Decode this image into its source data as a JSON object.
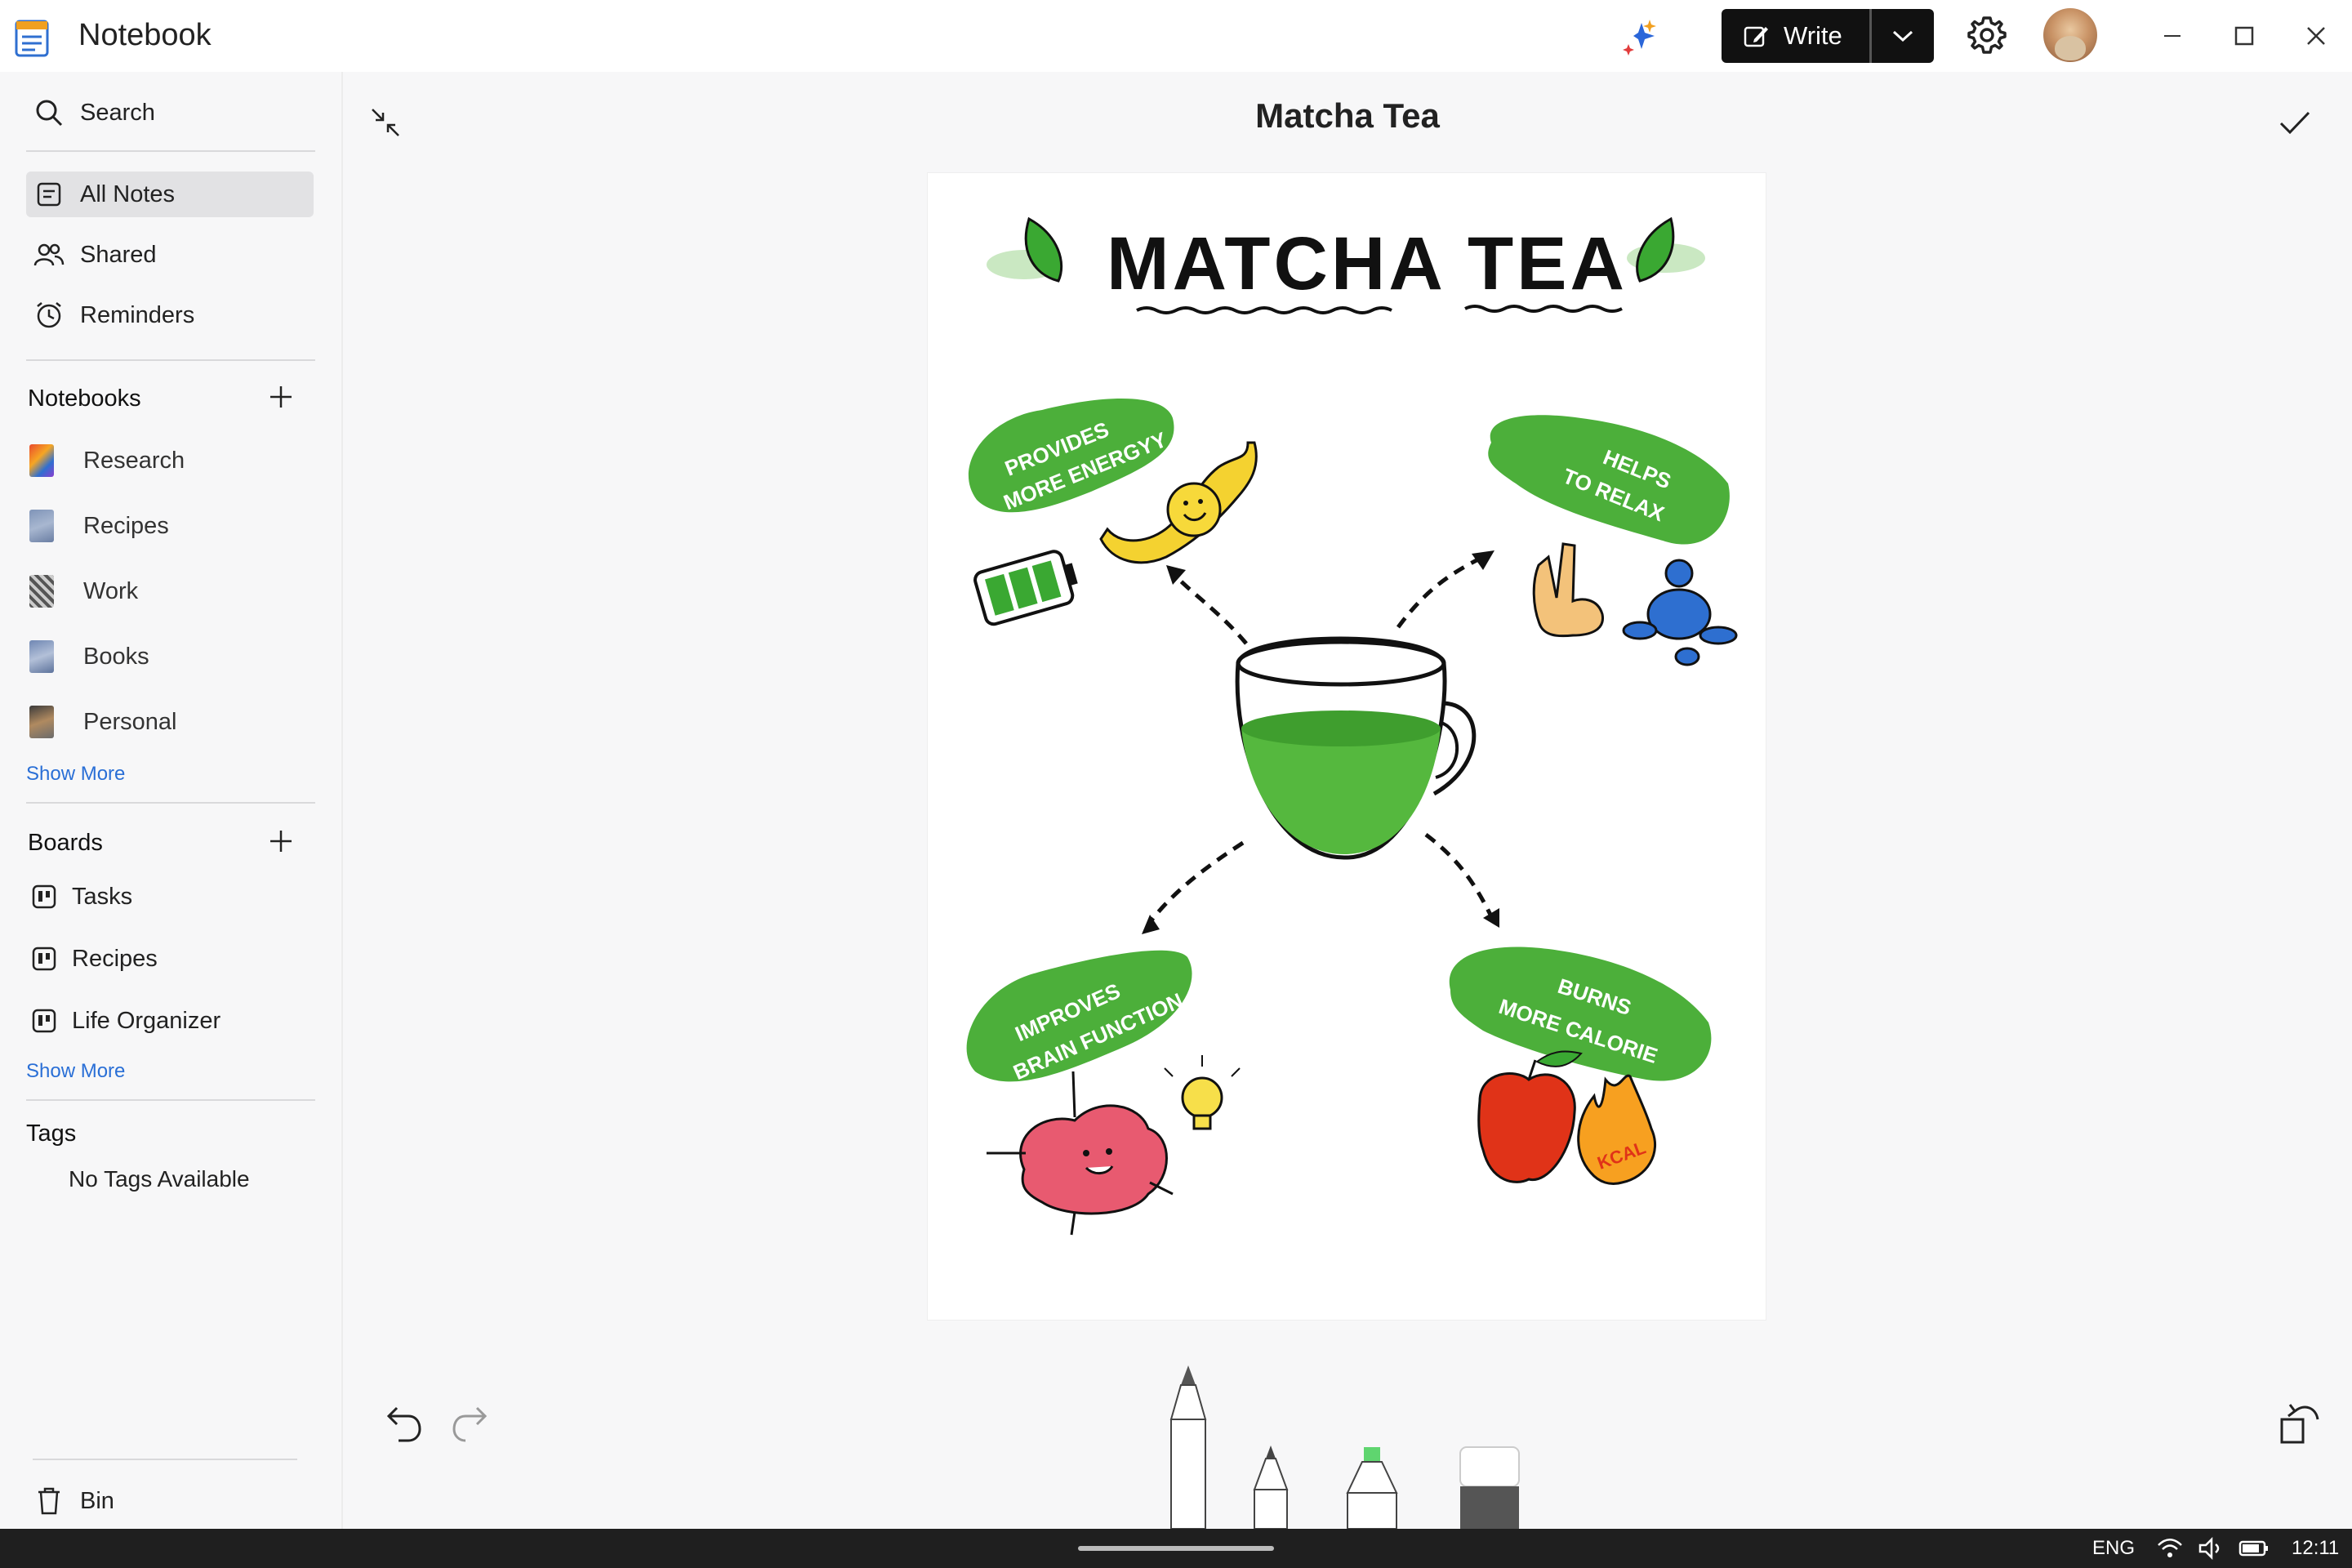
{
  "app": {
    "title": "Notebook"
  },
  "toolbar": {
    "write_label": "Write"
  },
  "sidebar": {
    "search_label": "Search",
    "nav": [
      {
        "label": "All Notes"
      },
      {
        "label": "Shared"
      },
      {
        "label": "Reminders"
      }
    ],
    "notebooks_heading": "Notebooks",
    "notebooks": [
      {
        "label": "Research"
      },
      {
        "label": "Recipes"
      },
      {
        "label": "Work"
      },
      {
        "label": "Books"
      },
      {
        "label": "Personal"
      }
    ],
    "notebooks_show_more": "Show More",
    "boards_heading": "Boards",
    "boards": [
      {
        "label": "Tasks"
      },
      {
        "label": "Recipes"
      },
      {
        "label": "Life Organizer"
      }
    ],
    "boards_show_more": "Show More",
    "tags_heading": "Tags",
    "tags_empty": "No Tags Available",
    "bin_label": "Bin"
  },
  "note": {
    "title": "Matcha Tea",
    "drawing": {
      "heading": "MATCHA TEA",
      "bubbles": [
        {
          "line1": "PROVIDES",
          "line2": "MORE ENERGYY"
        },
        {
          "line1": "HELPS",
          "line2": "TO RELAX"
        },
        {
          "line1": "IMPROVES",
          "line2": "BRAIN FUNCTION"
        },
        {
          "line1": "BURNS",
          "line2": "MORE CALORIE"
        }
      ],
      "flame_label": "KCAL"
    }
  },
  "taskbar": {
    "lang": "ENG",
    "time": "12:11"
  },
  "colors": {
    "accent_link": "#2a6fd6",
    "matcha_green": "#4caf3a",
    "write_button": "#111111"
  }
}
